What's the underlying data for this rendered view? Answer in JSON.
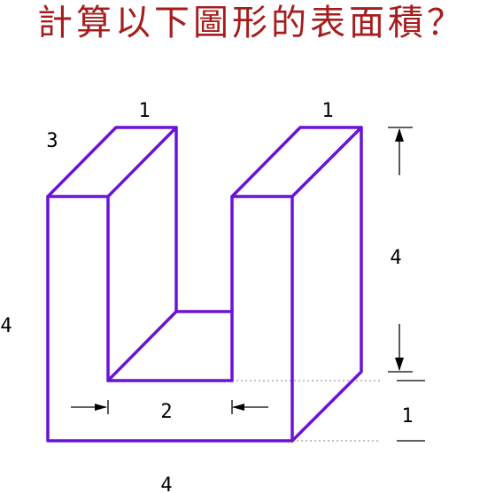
{
  "title": "計算以下圖形的表面積？",
  "colors": {
    "title": "#a51d1d",
    "edge": "#6a13d6"
  },
  "labels": {
    "top_left_width": "1",
    "top_right_width": "1",
    "depth": "3",
    "left_height": "4",
    "right_height": "4",
    "gap_width": "2",
    "base_height": "1",
    "bottom_width": "4"
  }
}
